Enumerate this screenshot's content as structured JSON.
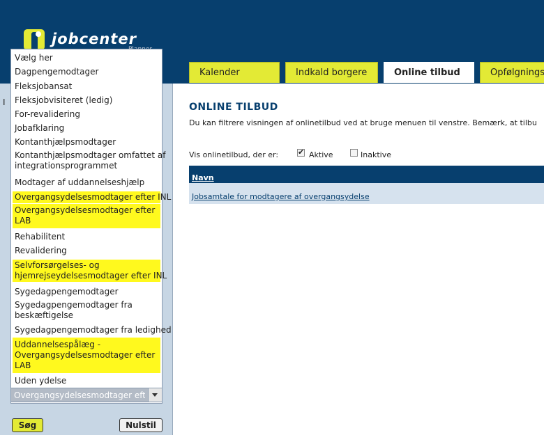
{
  "header": {
    "logo_text": "jobcenter",
    "logo_sub": "Planner"
  },
  "tabs": [
    {
      "label": "Kalender",
      "active": false
    },
    {
      "label": "Indkald borgere",
      "active": false
    },
    {
      "label": "Online tilbud",
      "active": true
    },
    {
      "label": "Opfølgningslis",
      "active": false
    }
  ],
  "sidebar": {
    "left_fragment": "I",
    "dropdown_options": [
      {
        "label": "Vælg her",
        "highlighted": false
      },
      {
        "label": "Dagpengemodtager",
        "highlighted": false
      },
      {
        "label": "Fleksjobansat",
        "highlighted": false
      },
      {
        "label": "Fleksjobvisiteret (ledig)",
        "highlighted": false
      },
      {
        "label": "For-revalidering",
        "highlighted": false
      },
      {
        "label": "Jobafklaring",
        "highlighted": false
      },
      {
        "label": "Kontanthjælpsmodtager",
        "highlighted": false
      },
      {
        "label_lines": [
          "Kontanthjælpsmodtager omfattet af",
          "integrationsprogrammet"
        ],
        "highlighted": false
      },
      {
        "label": "Modtager af uddannelseshjælp",
        "highlighted": false
      },
      {
        "label": "Overgangsydelsesmodtager efter INL",
        "highlighted": true
      },
      {
        "label_lines": [
          "Overgangsydelsesmodtager efter",
          "LAB"
        ],
        "highlighted": true
      },
      {
        "label": "Rehabilitent",
        "highlighted": false
      },
      {
        "label": "Revalidering",
        "highlighted": false
      },
      {
        "label_lines": [
          "Selvforsørgelses- og",
          "hjemrejseydelsesmodtager efter INL"
        ],
        "highlighted": true
      },
      {
        "label": "Sygedagpengemodtager",
        "highlighted": false
      },
      {
        "label_lines": [
          "Sygedagpengemodtager fra",
          "beskæftigelse"
        ],
        "highlighted": false
      },
      {
        "label": "Sygedagpengemodtager fra ledighed",
        "highlighted": false
      },
      {
        "label_lines": [
          "Uddannelsespålæg -",
          "Overgangsydelsesmodtager efter",
          "LAB"
        ],
        "highlighted": true
      },
      {
        "label": "Uden ydelse",
        "highlighted": false
      }
    ],
    "select_value": "Overgangsydelsesmodtager efter I",
    "search_button": "Søg",
    "reset_button": "Nulstil"
  },
  "main": {
    "title": "ONLINE TILBUD",
    "description": "Du kan filtrere visningen af onlinetilbud ved at bruge menuen til venstre. Bemærk, at tilbu",
    "filter_label": "Vis onlinetilbud, der er:",
    "filter_active": {
      "label": "Aktive",
      "checked": true
    },
    "filter_inactive": {
      "label": "Inaktive",
      "checked": false
    },
    "table": {
      "header": "Navn",
      "rows": [
        "Jobsamtale for modtagere af overgangsydelse"
      ]
    }
  },
  "colors": {
    "header_bg": "#073f6e",
    "accent_yellow": "#e3ea35",
    "highlight": "#fff91e",
    "sidebar_bg": "#c7d6e4"
  }
}
